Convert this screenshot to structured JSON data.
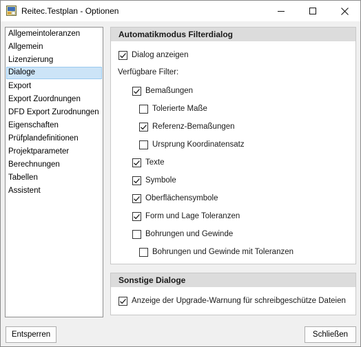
{
  "window": {
    "title": "Reitec.Testplan - Optionen",
    "controls": [
      "minimize",
      "maximize",
      "close"
    ]
  },
  "sidebar": {
    "selected": "Dialoge",
    "items": [
      {
        "label": "Allgemeintoleranzen"
      },
      {
        "label": "Allgemein"
      },
      {
        "label": "Lizenzierung"
      },
      {
        "label": "Dialoge"
      },
      {
        "label": "Export"
      },
      {
        "label": "Export Zuordnungen"
      },
      {
        "label": "DFD Export Zurodnungen"
      },
      {
        "label": "Eigenschaften"
      },
      {
        "label": "Prüfplandefinitionen"
      },
      {
        "label": "Projektparameter"
      },
      {
        "label": "Berechnungen"
      },
      {
        "label": "Tabellen"
      },
      {
        "label": "Assistent"
      }
    ]
  },
  "filter_group": {
    "title": "Automatikmodus Filterdialog",
    "show_dialog": {
      "label": "Dialog anzeigen",
      "checked": true
    },
    "available_label": "Verfügbare Filter:",
    "filters": [
      {
        "label": "Bemaßungen",
        "checked": true
      },
      {
        "label": "Tolerierte Maße",
        "checked": false
      },
      {
        "label": "Referenz-Bemaßungen",
        "checked": true
      },
      {
        "label": "Ursprung Koordinatensatz",
        "checked": false
      },
      {
        "label": "Texte",
        "checked": true
      },
      {
        "label": "Symbole",
        "checked": true
      },
      {
        "label": "Oberflächensymbole",
        "checked": true
      },
      {
        "label": "Form und Lage Toleranzen",
        "checked": true
      },
      {
        "label": "Bohrungen und Gewinde",
        "checked": false
      },
      {
        "label": "Bohrungen und Gewinde mit Toleranzen",
        "checked": false
      }
    ]
  },
  "other_group": {
    "title": "Sonstige Dialoge",
    "upgrade_warning": {
      "label": "Anzeige der Upgrade-Warnung für schreibgeschütze Dateien",
      "checked": true
    }
  },
  "footer": {
    "unlock_label": "Entsperren",
    "close_label": "Schließen"
  }
}
